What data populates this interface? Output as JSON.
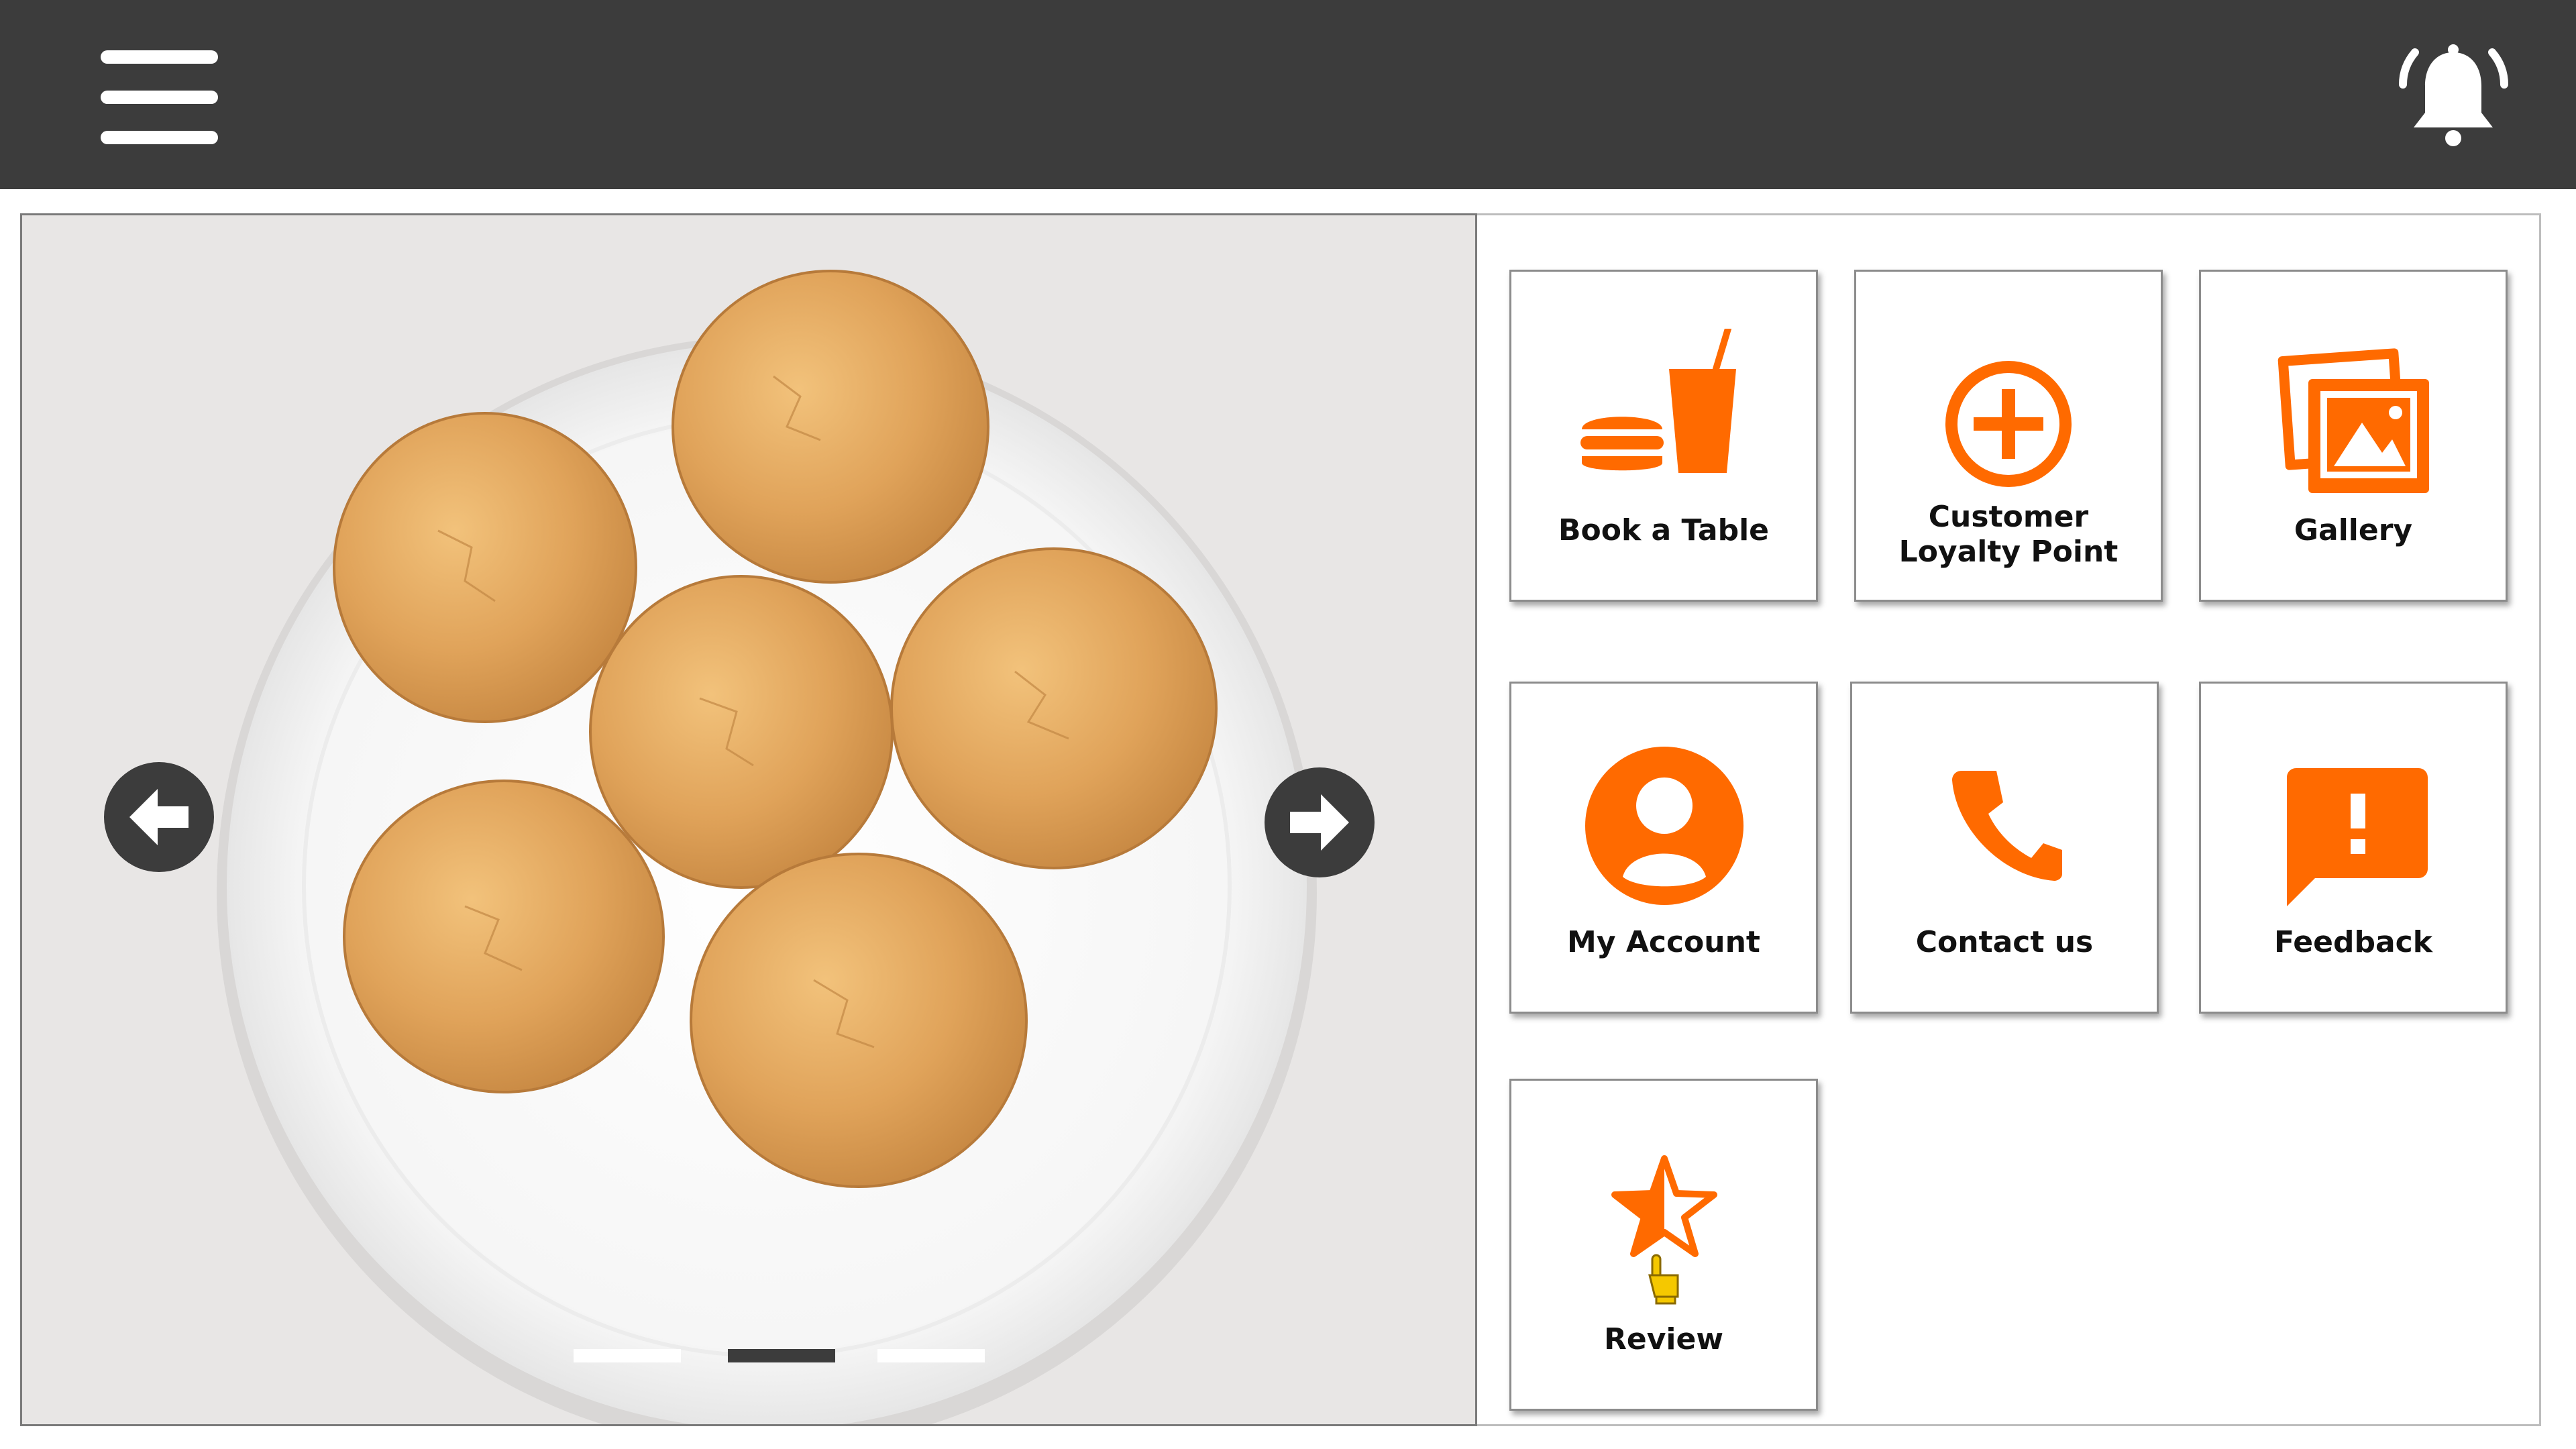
{
  "header": {
    "menu_icon": "hamburger-menu-icon",
    "notification_icon": "bell-icon"
  },
  "carousel": {
    "image": "plate of cookies",
    "prev_icon": "arrow-left-icon",
    "next_icon": "arrow-right-icon",
    "slide_count": 3,
    "active_slide": 2
  },
  "colors": {
    "header_bg": "#3c3c3c",
    "accent": "#ff6a00",
    "tile_border": "#8c8c8c"
  },
  "tiles": [
    {
      "label": "Book a Table",
      "icon": "food-drink-icon"
    },
    {
      "label": "Customer Loyalty Point",
      "icon": "plus-circle-icon"
    },
    {
      "label": "Gallery",
      "icon": "gallery-icon"
    },
    {
      "label": "My Account",
      "icon": "account-icon"
    },
    {
      "label": "Contact us",
      "icon": "phone-icon"
    },
    {
      "label": "Feedback",
      "icon": "feedback-icon"
    },
    {
      "label": "Review",
      "icon": "star-icon"
    }
  ]
}
